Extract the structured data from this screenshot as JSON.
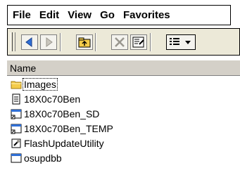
{
  "menubar": {
    "items": [
      "File",
      "Edit",
      "View",
      "Go",
      "Favorites"
    ]
  },
  "toolbar": {
    "buttons": [
      "back-icon",
      "forward-icon",
      "up-folder-icon",
      "delete-icon",
      "properties-icon",
      "views-icon"
    ]
  },
  "list_header": {
    "name_label": "Name"
  },
  "files": [
    {
      "name": "Images",
      "icon": "folder-icon"
    },
    {
      "name": "18X0c70Ben",
      "icon": "text-file-icon"
    },
    {
      "name": "18X0c70Ben_SD",
      "icon": "shortcut-icon"
    },
    {
      "name": "18X0c70Ben_TEMP",
      "icon": "shortcut-icon"
    },
    {
      "name": "FlashUpdateUtility",
      "icon": "executable-icon"
    },
    {
      "name": "osupdbb",
      "icon": "app-window-icon"
    }
  ],
  "colors": {
    "toolbar_bg": "#ece9d8",
    "header_bg": "#d4d0c8",
    "arrow_blue": "#2f6fd6",
    "folder_yellow": "#f4cc4a"
  }
}
